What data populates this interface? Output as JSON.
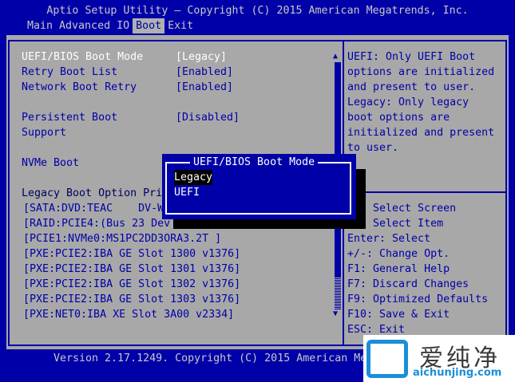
{
  "title": "Aptio Setup Utility – Copyright (C) 2015 American Megatrends, Inc.",
  "tabs": [
    "Main",
    "Advanced",
    "IO",
    "Boot",
    "Exit"
  ],
  "active_tab": "Boot",
  "settings": [
    {
      "label": "UEFI/BIOS Boot Mode",
      "value": "[Legacy]"
    },
    {
      "label": "Retry Boot List",
      "value": "[Enabled]"
    },
    {
      "label": "Network Boot Retry",
      "value": "[Enabled]"
    },
    {
      "label": "Persistent Boot",
      "label2": "Support",
      "value": "[Disabled]"
    },
    {
      "label": "NVMe Boot",
      "value": ""
    },
    {
      "label": "Legacy Boot Option Pri"
    }
  ],
  "boot_options": [
    "[SATA:DVD:TEAC    DV-W",
    "[RAID:PCIE4:(Bus 23 Dev",
    "[PCIE1:NVMe0:MS1PC2DD3ORA3.2T ]",
    "[PXE:PCIE2:IBA GE Slot 1300 v1376]",
    "[PXE:PCIE2:IBA GE Slot 1301 v1376]",
    "[PXE:PCIE2:IBA GE Slot 1302 v1376]",
    "[PXE:PCIE2:IBA GE Slot 1303 v1376]",
    "[PXE:NET0:IBA XE Slot 3A00 v2334]"
  ],
  "help": [
    "UEFI: Only UEFI Boot",
    "options are initialized",
    "and present to user.",
    "Legacy: Only legacy",
    "boot options are",
    "initialized and present",
    "to user."
  ],
  "keys": [
    "    Select Screen",
    "    Select Item",
    "Enter: Select",
    "+/-: Change Opt.",
    "F1: General Help",
    "F7: Discard Changes",
    "F9: Optimized Defaults",
    "F10: Save & Exit",
    "ESC: Exit"
  ],
  "popup": {
    "title": "UEFI/BIOS Boot Mode",
    "options": [
      "Legacy",
      "UEFI"
    ],
    "selected": "Legacy"
  },
  "footer": "Version 2.17.1249. Copyright (C) 2015 American Megatrends, Inc.",
  "watermark": {
    "text": "爱纯净",
    "url": "aichunjing.com"
  }
}
